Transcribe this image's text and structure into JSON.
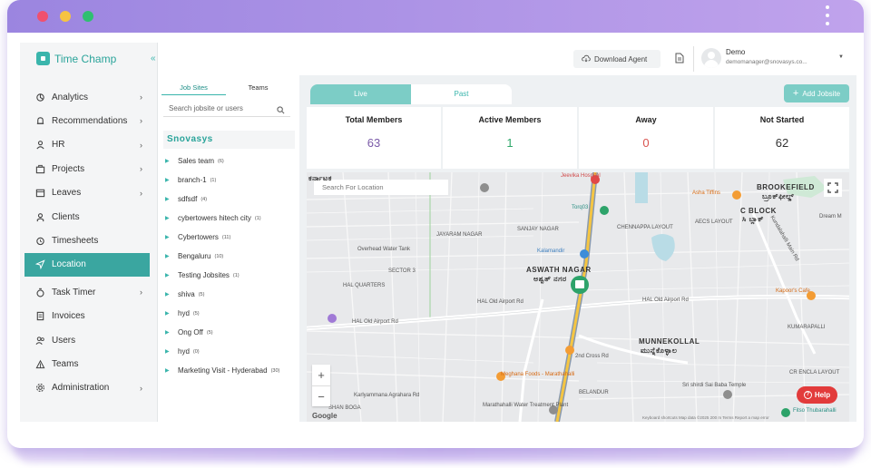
{
  "app": {
    "name": "Time Champ",
    "collapse_icon": "double-chevron-left-icon"
  },
  "sidebar": {
    "items": [
      {
        "label": "Analytics",
        "icon": "analytics-icon",
        "chevron": "›"
      },
      {
        "label": "Recommendations",
        "icon": "bell-icon",
        "chevron": "›"
      },
      {
        "label": "HR",
        "icon": "user-icon",
        "chevron": "›"
      },
      {
        "label": "Projects",
        "icon": "briefcase-icon",
        "chevron": "›"
      },
      {
        "label": "Leaves",
        "icon": "calendar-icon",
        "chevron": "›"
      },
      {
        "label": "Clients",
        "icon": "person-icon",
        "chevron": ""
      },
      {
        "label": "Timesheets",
        "icon": "alarm-icon",
        "chevron": ""
      },
      {
        "label": "Location",
        "icon": "location-arrow-icon",
        "chevron": "",
        "active": true
      },
      {
        "label": "Task Timer",
        "icon": "timer-icon",
        "chevron": "›"
      },
      {
        "label": "Invoices",
        "icon": "invoice-icon",
        "chevron": ""
      },
      {
        "label": "Users",
        "icon": "users-icon",
        "chevron": ""
      },
      {
        "label": "Teams",
        "icon": "teams-icon",
        "chevron": ""
      },
      {
        "label": "Administration",
        "icon": "gear-icon",
        "chevron": "›"
      }
    ],
    "accent_color": "#3aa6a0"
  },
  "jobsites": {
    "tabs": [
      "Job Sites",
      "Teams"
    ],
    "search_placeholder": "Search jobsite or users",
    "group": "Snovasys",
    "items": [
      {
        "name": "Sales team",
        "count": "(6)"
      },
      {
        "name": "branch-1",
        "count": "(1)"
      },
      {
        "name": "sdfsdf",
        "count": "(4)"
      },
      {
        "name": "cybertowers hitech city",
        "count": "(1)"
      },
      {
        "name": "Cybertowers",
        "count": "(11)"
      },
      {
        "name": "Bengaluru",
        "count": "(10)"
      },
      {
        "name": "Testing Jobsites",
        "count": "(1)"
      },
      {
        "name": "shiva",
        "count": "(5)"
      },
      {
        "name": "hyd",
        "count": "(5)"
      },
      {
        "name": "Ong Off",
        "count": "(5)"
      },
      {
        "name": "hyd",
        "count": "(0)"
      },
      {
        "name": "Marketing Visit - Hyderabad",
        "count": "(30)"
      }
    ]
  },
  "topbar": {
    "download_label": "Download Agent",
    "user_name": "Demo",
    "user_email": "demomanager@snovasys.co..."
  },
  "period_tabs": {
    "live": "Live",
    "past": "Past"
  },
  "add_jobsite_label": "Add Jobsite",
  "stats": [
    {
      "label": "Total Members",
      "value": "63",
      "color": "#7a5aa8"
    },
    {
      "label": "Active Members",
      "value": "1",
      "color": "#2fa86a"
    },
    {
      "label": "Away",
      "value": "0",
      "color": "#d9534f"
    },
    {
      "label": "Not Started",
      "value": "62",
      "color": "#333333"
    }
  ],
  "map": {
    "search_placeholder": "Search For Location",
    "labels": {
      "aswath_nagar": "ASWATH NAGAR",
      "aswath_kn": "ಅಶ್ವತ್ ನಗರ",
      "munnekollal": "MUNNEKOLLAL",
      "munnekollal_kn": "ಮುನ್ನೆಕೊಳ್ಳಾಲ",
      "brookefield": "BROOKEFIELD",
      "brookefield_kn": "ಬ್ರೂಕ್‌ಫೀಲ್ಡ್",
      "c_block": "C BLOCK",
      "c_block_kn": "ಸಿ ಬ್ಲಾಕ್",
      "jeevika": "Jeevika Hospital",
      "asha": "Asha Tiffins",
      "torq": "Torq03",
      "kalamandir": "Kalamandir",
      "kapoor": "Kapoor's Cafe",
      "meghana": "Meghana Foods - Marathahalli",
      "sai": "Sri shirdi Sai Baba Temple",
      "fitso": "Fitso Thubarahalli",
      "hal1": "HAL Old Airport Rd",
      "hal2": "HAL Old Airport Rd",
      "hal3": "HAL Old Airport Rd",
      "cross": "2nd Cross Rd",
      "kundalahalli": "Kundalahalli Main Rd",
      "sanjay": "SANJAY NAGAR",
      "jayaram": "JAYARAM NAGAR",
      "chennappa": "CHENNAPPA LAYOUT",
      "sector3": "SECTOR 3",
      "hal_quarters": "HAL QUARTERS",
      "overhead": "Overhead Water Tank",
      "karnataka": "ಕರ್ನಾಟಕ",
      "kumarapalli": "KUMARAPALLI",
      "marathahalli_water": "Marathahalli Water Treatment Plant",
      "karlyammana": "Karlyammana Agrahara Rd",
      "belandur": "BELANDUR",
      "shanboga": "SHAN BOGA",
      "aecs": "AECS LAYOUT",
      "dream": "Dream M",
      "crenclave": "CR ENCLA LAYOUT",
      "google": "Google",
      "attribution": "Keyboard shortcuts   Map data ©2025   200 m   Terms   Report a map error"
    },
    "zoom_in": "+",
    "zoom_out": "−"
  },
  "help_label": "Help"
}
